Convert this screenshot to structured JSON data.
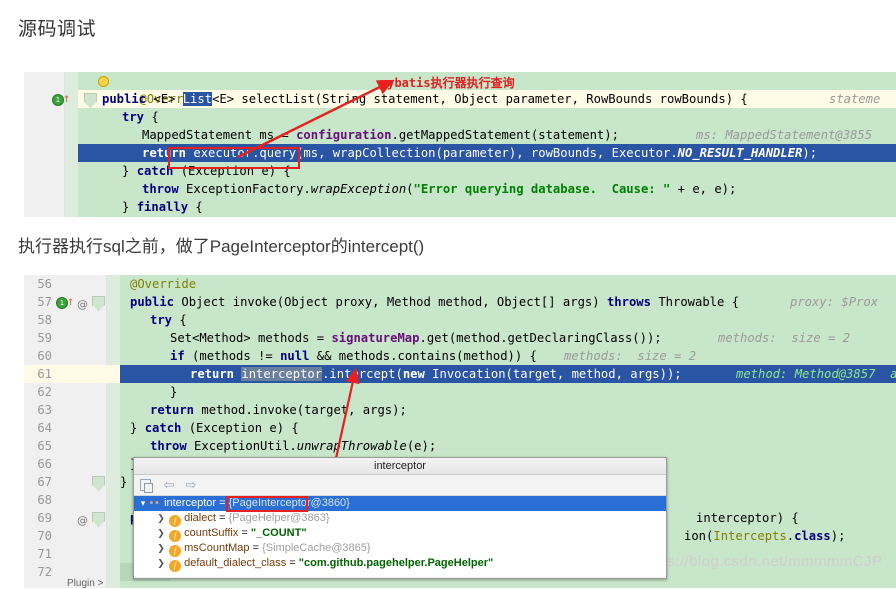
{
  "page": {
    "title": "源码调试",
    "middle_text": "执行器执行sql之前，做了PageInterceptor的intercept()",
    "watermark": "https://blog.csdn.net/mmmmmCJP",
    "plugin_tab": "Plugin  >"
  },
  "annotations": {
    "red_note_top": "mybatis执行器执行查询"
  },
  "code_block_1": {
    "lines": [
      {
        "text": "@Override"
      },
      {
        "text": "public <E> List<E> selectList(String statement, Object parameter, RowBounds rowBounds) {"
      },
      {
        "hint": "stateme"
      },
      {
        "text": "try {"
      },
      {
        "text": "MappedStatement ms = configuration.getMappedStatement(statement);"
      },
      {
        "hint": "ms: MappedStatement@3855"
      },
      {
        "text": "return executor.query(ms, wrapCollection(parameter), rowBounds, Executor.NO_RESULT_HANDLER);"
      },
      {
        "text": "} catch (Exception e) {"
      },
      {
        "text": "throw ExceptionFactory.wrapException(\"Error querying database.  Cause: \" + e, e);"
      },
      {
        "text": "} finally {"
      }
    ],
    "selected_word": "List",
    "boxed_text": "executor.query("
  },
  "code_block_2": {
    "line_numbers": [
      "56",
      "57",
      "58",
      "59",
      "60",
      "61",
      "62",
      "63",
      "64",
      "65",
      "66",
      "67",
      "68",
      "69",
      "70",
      "71",
      "72"
    ],
    "lines": [
      {
        "no": "56",
        "text": "@Override"
      },
      {
        "no": "57",
        "text": "public Object invoke(Object proxy, Method method, Object[] args) throws Throwable {",
        "hint": "proxy: $Prox"
      },
      {
        "no": "58",
        "text": "try {"
      },
      {
        "no": "59",
        "text": "Set<Method> methods = signatureMap.get(method.getDeclaringClass());",
        "hint": "methods:  size = 2"
      },
      {
        "no": "60",
        "text": "if (methods != null && methods.contains(method)) {",
        "hint": "methods:  size = 2"
      },
      {
        "no": "61",
        "text": "return interceptor.intercept(new Invocation(target, method, args));",
        "hint": "method: Method@3857  a"
      },
      {
        "no": "62",
        "text": "}"
      },
      {
        "no": "63",
        "text": "return method.invoke(target, args);"
      },
      {
        "no": "64",
        "text": "} catch (Exception e) {"
      },
      {
        "no": "65",
        "text": "throw ExceptionUtil.unwrapThrowable(e);"
      },
      {
        "no": "66",
        "text": "}"
      },
      {
        "no": "67",
        "text": "}"
      },
      {
        "no": "68",
        "text": ""
      },
      {
        "no": "69",
        "text": "pri",
        "tail": "interceptor) {"
      },
      {
        "no": "70",
        "text": "I",
        "tail": "ion(Intercepts.class);"
      },
      {
        "no": "71",
        "text": "/"
      },
      {
        "no": "72",
        "text": "i"
      }
    ],
    "highlighted_word": "interceptor"
  },
  "popup": {
    "title": "interceptor",
    "toolbar_icons": [
      "copy-icon",
      "back-arrow-icon",
      "forward-arrow-icon"
    ],
    "rows": [
      {
        "indent": 0,
        "chevron": "v",
        "icon": "glasses-icon",
        "name": "interceptor",
        "eq": " = ",
        "value": "{PageInterceptor@3860}",
        "value_type": "ref",
        "selected": true
      },
      {
        "indent": 1,
        "chevron": ">",
        "icon": "field-icon",
        "name": "dialect",
        "eq": " = ",
        "value": "{PageHelper@3863}",
        "value_type": "ref",
        "selected": false
      },
      {
        "indent": 1,
        "chevron": ">",
        "icon": "field-icon",
        "name": "countSuffix",
        "eq": " = ",
        "value": "\"_COUNT\"",
        "value_type": "str",
        "selected": false
      },
      {
        "indent": 1,
        "chevron": ">",
        "icon": "field-icon",
        "name": "msCountMap",
        "eq": " = ",
        "value": "{SimpleCache@3865}",
        "value_type": "ref",
        "selected": false
      },
      {
        "indent": 1,
        "chevron": ">",
        "icon": "field-icon",
        "name": "default_dialect_class",
        "eq": " = ",
        "value": "\"com.github.pagehelper.PageHelper\"",
        "value_type": "str",
        "selected": false
      }
    ],
    "boxed_value": "{PageInterceptor@3860}"
  },
  "colors": {
    "code_bg": "#c8e6c9",
    "gutter_bg": "#f0f0f0",
    "selection_blue": "#2a54a4",
    "caret_row": "#fffbe6",
    "annotation_red": "#e02020",
    "tree_selected": "#2a6fd6"
  }
}
